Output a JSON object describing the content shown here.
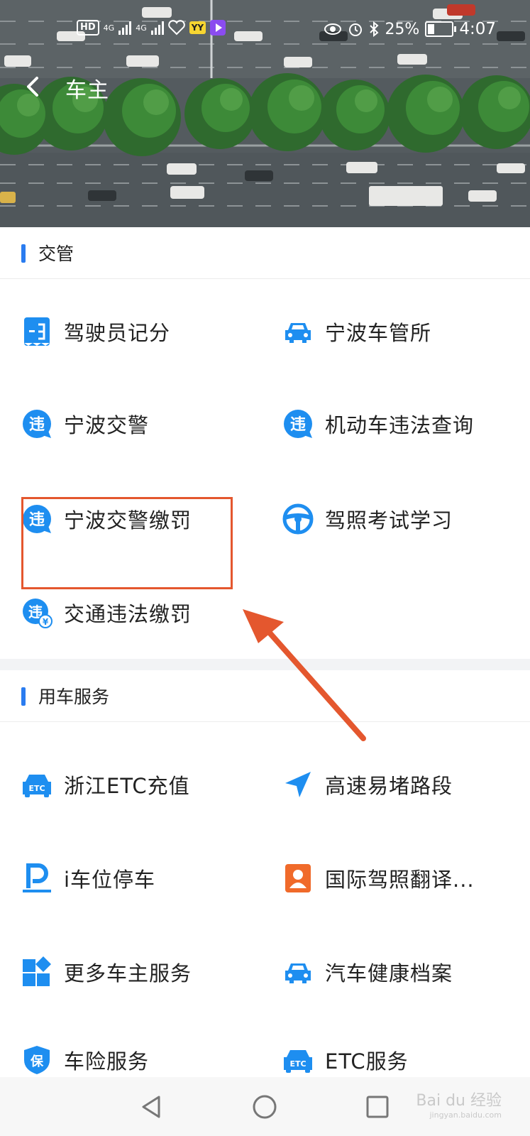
{
  "status_bar": {
    "left_badges": [
      "HD",
      "4G",
      "4G",
      "YY"
    ],
    "battery": "25%",
    "time": "4:07"
  },
  "navbar": {
    "title": "车主"
  },
  "sections": [
    {
      "title": "交管",
      "items": [
        {
          "label": "驾驶员记分",
          "icon": "score-card-icon"
        },
        {
          "label": "宁波车管所",
          "icon": "car-icon"
        },
        {
          "label": "宁波交警",
          "icon": "violation-bubble-icon"
        },
        {
          "label": "机动车违法查询",
          "icon": "violation-bubble-icon"
        },
        {
          "label": "宁波交警缴罚",
          "icon": "violation-bubble-icon"
        },
        {
          "label": "驾照考试学习",
          "icon": "steering-wheel-icon"
        },
        {
          "label": "交通违法缴罚",
          "icon": "violation-payment-icon"
        }
      ]
    },
    {
      "title": "用车服务",
      "items": [
        {
          "label": "浙江ETC充值",
          "icon": "etc-car-icon"
        },
        {
          "label": "高速易堵路段",
          "icon": "navigation-arrow-icon"
        },
        {
          "label": "i车位停车",
          "icon": "parking-icon"
        },
        {
          "label": "国际驾照翻译...",
          "icon": "id-card-icon"
        },
        {
          "label": "更多车主服务",
          "icon": "grid-apps-icon"
        },
        {
          "label": "汽车健康档案",
          "icon": "car-icon"
        },
        {
          "label": "车险服务",
          "icon": "insurance-shield-icon"
        },
        {
          "label": "ETC服务",
          "icon": "etc-car-icon"
        }
      ]
    }
  ],
  "watermark": {
    "text": "Bai du 经验",
    "sub": "jingyan.baidu.com"
  },
  "colors": {
    "accent": "#2a7cf0",
    "icon_blue": "#1e8ef0",
    "annotation": "#e4572e",
    "id_card": "#f06a2a"
  }
}
